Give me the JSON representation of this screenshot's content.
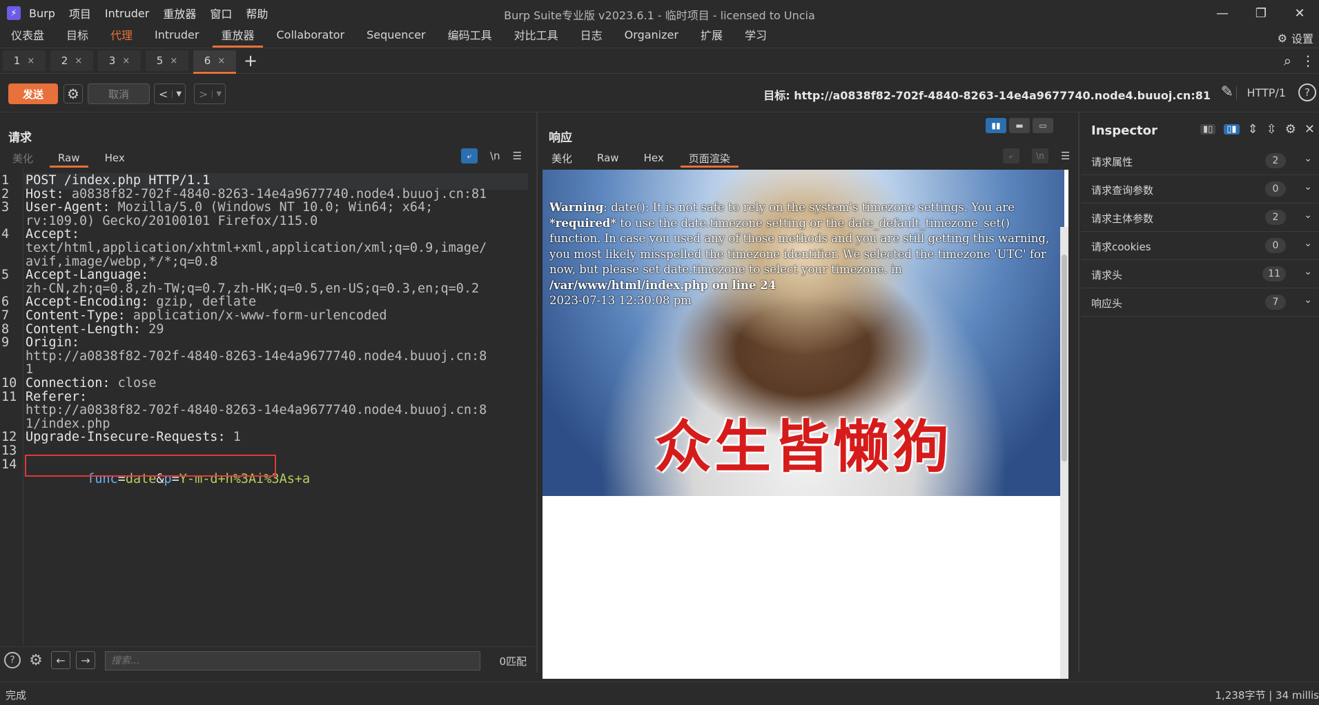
{
  "titlebar": {
    "app_name": "Burp",
    "menus": [
      "Burp",
      "项目",
      "Intruder",
      "重放器",
      "窗口",
      "帮助"
    ],
    "title": "Burp Suite专业版  v2023.6.1 - 临时项目 - licensed to Uncia"
  },
  "nav": {
    "tabs": [
      "仪表盘",
      "目标",
      "代理",
      "Intruder",
      "重放器",
      "Collaborator",
      "Sequencer",
      "编码工具",
      "对比工具",
      "日志",
      "Organizer",
      "扩展",
      "学习"
    ],
    "settings_label": "设置"
  },
  "repeater_tabs": [
    "1",
    "2",
    "3",
    "5",
    "6"
  ],
  "toolbar": {
    "send_label": "发送",
    "cancel_label": "取消",
    "target_label": "目标: http://a0838f82-702f-4840-8263-14e4a9677740.node4.buuoj.cn:81",
    "http_version": "HTTP/1"
  },
  "request": {
    "title": "请求",
    "tabs": [
      "美化",
      "Raw",
      "Hex"
    ],
    "lines": [
      {
        "n": "1",
        "key": "POST /index.php HTTP/1.1",
        "val": ""
      },
      {
        "n": "2",
        "key": "Host:",
        "val": " a0838f82-702f-4840-8263-14e4a9677740.node4.buuoj.cn:81"
      },
      {
        "n": "3",
        "key": "User-Agent:",
        "val": " Mozilla/5.0 (Windows NT 10.0; Win64; x64;"
      },
      {
        "n": "",
        "key": "",
        "val": "rv:109.0) Gecko/20100101 Firefox/115.0"
      },
      {
        "n": "4",
        "key": "Accept:",
        "val": ""
      },
      {
        "n": "",
        "key": "",
        "val": "text/html,application/xhtml+xml,application/xml;q=0.9,image/"
      },
      {
        "n": "",
        "key": "",
        "val": "avif,image/webp,*/*;q=0.8"
      },
      {
        "n": "5",
        "key": "Accept-Language:",
        "val": ""
      },
      {
        "n": "",
        "key": "",
        "val": "zh-CN,zh;q=0.8,zh-TW;q=0.7,zh-HK;q=0.5,en-US;q=0.3,en;q=0.2"
      },
      {
        "n": "6",
        "key": "Accept-Encoding:",
        "val": " gzip, deflate"
      },
      {
        "n": "7",
        "key": "Content-Type:",
        "val": " application/x-www-form-urlencoded"
      },
      {
        "n": "8",
        "key": "Content-Length:",
        "val": " 29"
      },
      {
        "n": "9",
        "key": "Origin:",
        "val": ""
      },
      {
        "n": "",
        "key": "",
        "val": "http://a0838f82-702f-4840-8263-14e4a9677740.node4.buuoj.cn:8"
      },
      {
        "n": "",
        "key": "",
        "val": "1"
      },
      {
        "n": "10",
        "key": "Connection:",
        "val": " close"
      },
      {
        "n": "11",
        "key": "Referer:",
        "val": ""
      },
      {
        "n": "",
        "key": "",
        "val": "http://a0838f82-702f-4840-8263-14e4a9677740.node4.buuoj.cn:8"
      },
      {
        "n": "",
        "key": "",
        "val": "1/index.php"
      },
      {
        "n": "12",
        "key": "Upgrade-Insecure-Requests:",
        "val": " 1"
      },
      {
        "n": "13",
        "key": "",
        "val": ""
      }
    ],
    "body_line_no": "14",
    "body": {
      "k1": "func",
      "v1": "date",
      "amp": "&",
      "k2": "p",
      "v2": "Y-m-d+h%3Ai%3As+a"
    },
    "search_placeholder": "搜索...",
    "match_count": "0匹配"
  },
  "response": {
    "title": "响应",
    "tabs": [
      "美化",
      "Raw",
      "Hex",
      "页面渲染"
    ],
    "warning_label": "Warning",
    "warning_text": ": date(): It is not safe to rely on the system's timezone settings. You are ",
    "required_text": "*required*",
    "mid_text": " to use the date.timezone setting or the date_default_timezone_set() function. In case you used any of those methods and you are still getting this warning, you most likely misspelled the timezone identifier. We selected the timezone 'UTC' for now, but please set date.timezone to select your timezone. in ",
    "file_path": "/var/www/html/index.php",
    "on_line": " on line ",
    "line_no": "24",
    "date_output": "2023-07-13 12:30:08 pm",
    "meme_caption": "众生皆懒狗"
  },
  "inspector": {
    "title": "Inspector",
    "rows": [
      {
        "label": "请求属性",
        "count": "2"
      },
      {
        "label": "请求查询参数",
        "count": "0"
      },
      {
        "label": "请求主体参数",
        "count": "2"
      },
      {
        "label": "请求cookies",
        "count": "0"
      },
      {
        "label": "请求头",
        "count": "11"
      },
      {
        "label": "响应头",
        "count": "7"
      }
    ]
  },
  "status": {
    "left": "完成",
    "right": "1,238字节 | 34 millis"
  },
  "colors": {
    "accent": "#e8703a",
    "active_blue": "#2a6fb0",
    "highlight_box": "#e0393e"
  }
}
